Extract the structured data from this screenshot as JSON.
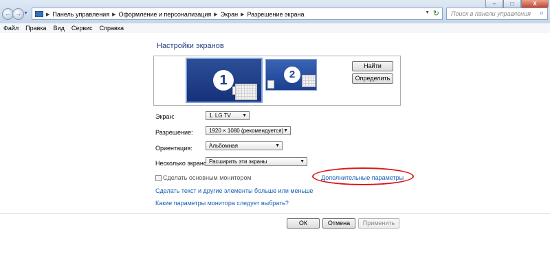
{
  "window": {
    "nav_back": "←",
    "nav_forward": "→",
    "nav_dropdown": "▼",
    "breadcrumbs": [
      "Панель управления",
      "Оформление и персонализация",
      "Экран",
      "Разрешение экрана"
    ],
    "breadcrumb_sep": "▶",
    "address_dropdown": "▼",
    "refresh": "↻",
    "search_placeholder": "Поиск в панели управления",
    "search_icon": "⌕",
    "minimize": "–",
    "maximize": "□",
    "close": "X"
  },
  "menu": {
    "file": "Файл",
    "edit": "Правка",
    "view": "Вид",
    "tools": "Сервис",
    "help": "Справка"
  },
  "page": {
    "title": "Настройки экранов",
    "monitors": [
      {
        "number": "1",
        "selected": true
      },
      {
        "number": "2",
        "selected": false
      }
    ],
    "detect_button": "Найти",
    "identify_button": "Определить",
    "fields": {
      "display_label": "Экран:",
      "display_value": "1. LG TV",
      "resolution_label": "Разрешение:",
      "resolution_value": "1920 × 1080 (рекомендуется)",
      "orientation_label": "Ориентация:",
      "orientation_value": "Альбомная",
      "multiple_label": "Несколько экранов:",
      "multiple_value": "Расширить эти экраны"
    },
    "dropdown_arrow": "▼",
    "primary_checkbox_label": "Сделать основным монитором",
    "primary_checked": false,
    "advanced_link": "Дополнительные параметры",
    "link_text_size": "Сделать текст и другие элементы больше или меньше",
    "link_monitor_choice": "Какие параметры монитора следует выбрать?"
  },
  "footer": {
    "ok": "ОК",
    "cancel": "Отмена",
    "apply": "Применить"
  },
  "colors": {
    "selected_monitor": "#1f3f8a",
    "link": "#1a5fb4",
    "annotation_circle": "#e01515"
  }
}
